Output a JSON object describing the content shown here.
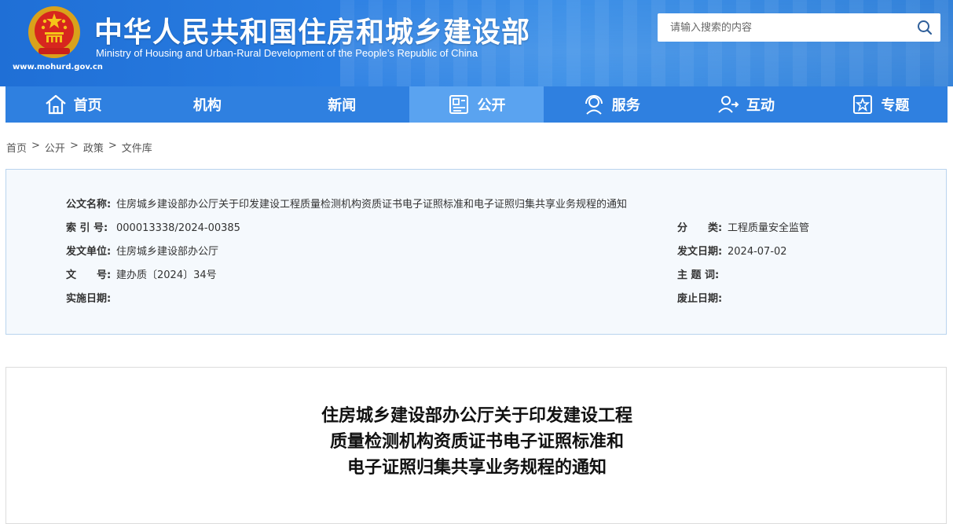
{
  "header": {
    "title_cn": "中华人民共和国住房和城乡建设部",
    "title_en": "Ministry of Housing and Urban-Rural Development of the People’s Republic of China",
    "site_url": "www.mohurd.gov.cn",
    "search_placeholder": "请输入搜索的内容",
    "colors": {
      "header_blue": "#2a7ee2",
      "nav_blue": "#2f80e0",
      "nav_active": "#5aa3f0"
    }
  },
  "nav": {
    "items": [
      {
        "label": "首页",
        "icon": "home-icon"
      },
      {
        "label": "机构",
        "icon": ""
      },
      {
        "label": "新闻",
        "icon": ""
      },
      {
        "label": "公开",
        "icon": "disclosure-icon",
        "active": true
      },
      {
        "label": "服务",
        "icon": "service-icon"
      },
      {
        "label": "互动",
        "icon": "interact-icon"
      },
      {
        "label": "专题",
        "icon": "topic-icon"
      }
    ]
  },
  "breadcrumb": [
    "首页",
    "公开",
    "政策",
    "文件库"
  ],
  "breadcrumb_sep": ">",
  "info": {
    "name_label": "公文名称:",
    "name_value": "住房城乡建设部办公厅关于印发建设工程质量检测机构资质证书电子证照标准和电子证照归集共享业务规程的通知",
    "index_label": "索 引 号:",
    "index_value": "000013338/2024-00385",
    "category_label": "分　　类:",
    "category_value": "工程质量安全监管",
    "issuer_label": "发文单位:",
    "issuer_value": "住房城乡建设部办公厅",
    "date_label": "发文日期:",
    "date_value": "2024-07-02",
    "docno_label": "文　　号:",
    "docno_value": "建办质〔2024〕34号",
    "keywords_label": "主 题 词:",
    "keywords_value": "",
    "effective_label": "实施日期:",
    "effective_value": "",
    "expire_label": "废止日期:",
    "expire_value": ""
  },
  "article": {
    "title_line1": "住房城乡建设部办公厅关于印发建设工程",
    "title_line2": "质量检测机构资质证书电子证照标准和",
    "title_line3": "电子证照归集共享业务规程的通知"
  }
}
